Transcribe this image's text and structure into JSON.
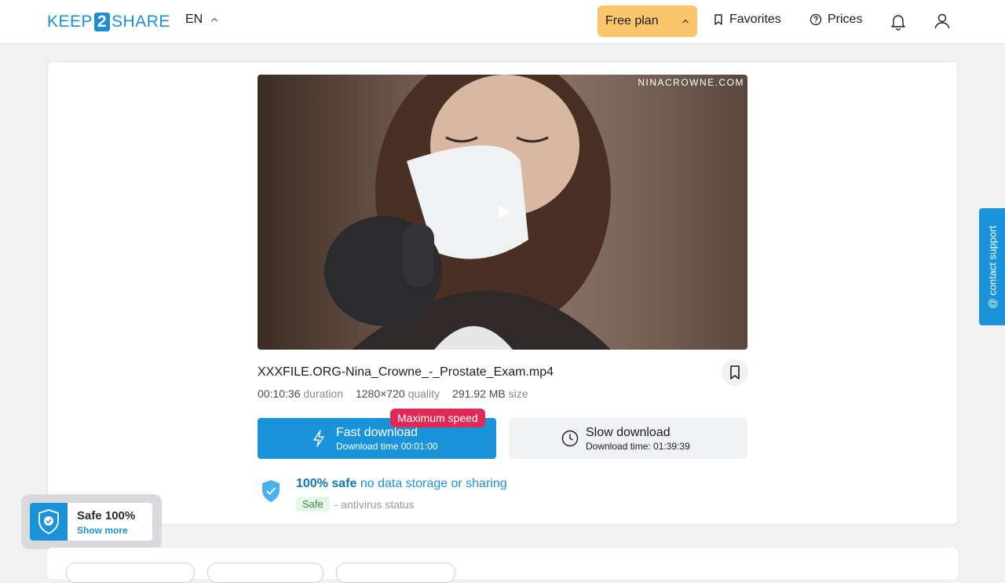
{
  "header": {
    "logo": {
      "pre": "KEEP",
      "num": "2",
      "post": "SHARE"
    },
    "language": "EN",
    "plan_label": "Free plan",
    "favorites_label": "Favorites",
    "prices_label": "Prices"
  },
  "video": {
    "watermark": "NINACROWNE.COM"
  },
  "file": {
    "name": "XXXFILE.ORG-Nina_Crowne_-_Prostate_Exam.mp4",
    "duration_value": "00:10:36",
    "duration_label": "duration",
    "quality_value": "1280×720",
    "quality_label": "quality",
    "size_value": "291.92 MB",
    "size_label": "size"
  },
  "download": {
    "max_speed_badge": "Maximum speed",
    "fast_title": "Fast download",
    "fast_sub": "Download time 00:01:00",
    "slow_title": "Slow download",
    "slow_sub": "Download time: 01:39:39"
  },
  "safety": {
    "strong": "100% safe",
    "light": "no data storage or sharing",
    "av_badge": "Safe",
    "av_text": "- antivirus status"
  },
  "safe_widget": {
    "title": "Safe 100%",
    "link": "Show more"
  },
  "support_label": "@ contact support",
  "colors": {
    "accent": "#1a93db",
    "plan": "#fcc56b",
    "badge": "#e02a55"
  }
}
